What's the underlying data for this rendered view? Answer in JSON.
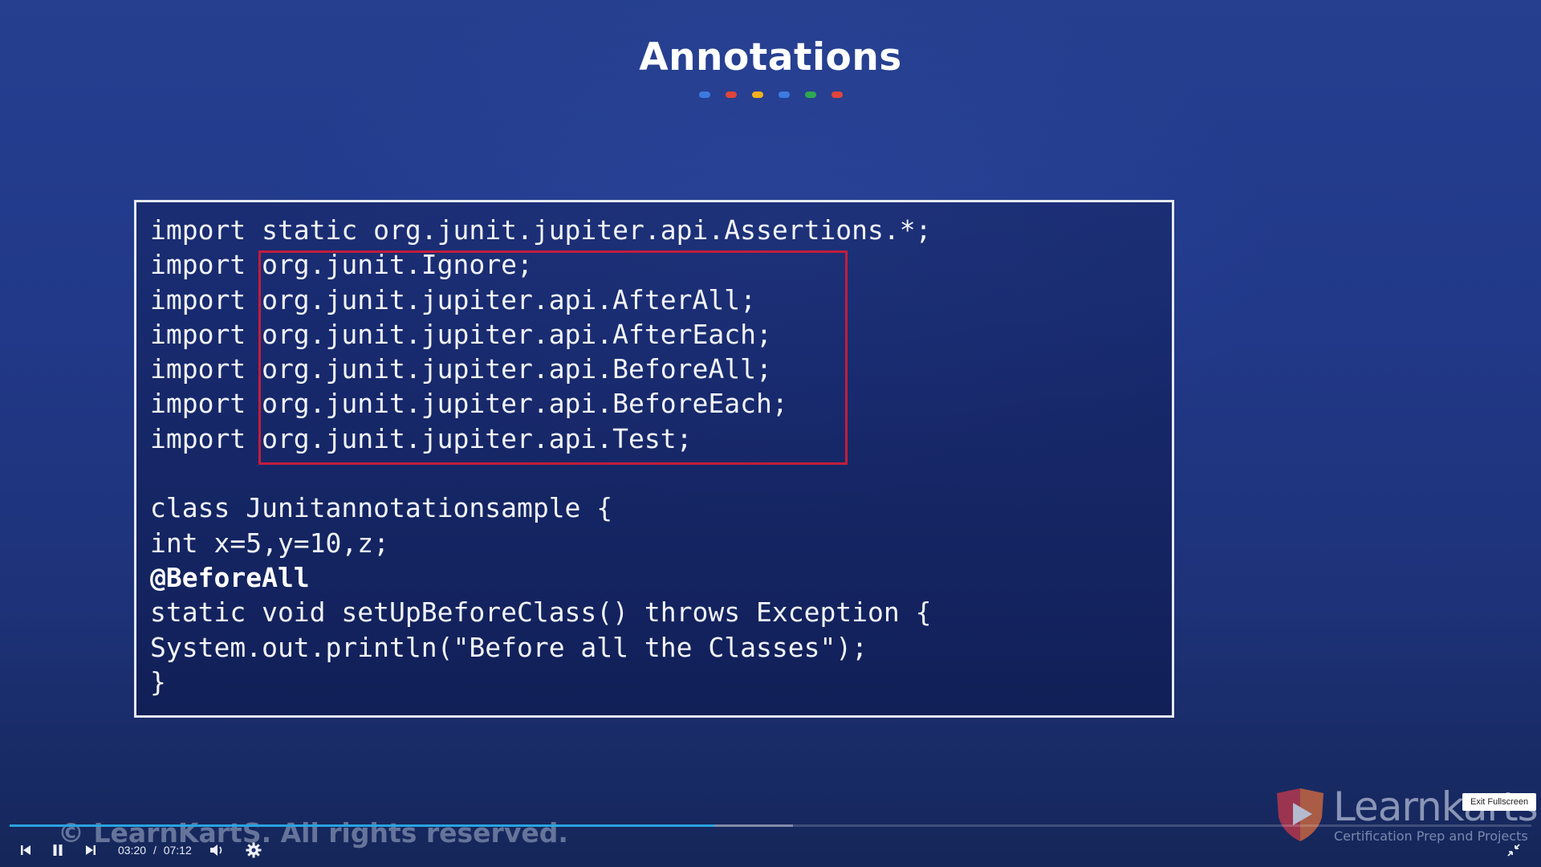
{
  "slide": {
    "title": "Annotations",
    "dot_colors": [
      "#3b7be0",
      "#e0453a",
      "#f2b11e",
      "#3b7be0",
      "#2ea84f",
      "#e0453a"
    ],
    "code_lines": [
      {
        "text": "import static org.junit.jupiter.api.Assertions.*;",
        "bold": false
      },
      {
        "text": "import org.junit.Ignore;",
        "bold": false
      },
      {
        "text": "import org.junit.jupiter.api.AfterAll;",
        "bold": false
      },
      {
        "text": "import org.junit.jupiter.api.AfterEach;",
        "bold": false
      },
      {
        "text": "import org.junit.jupiter.api.BeforeAll;",
        "bold": false
      },
      {
        "text": "import org.junit.jupiter.api.BeforeEach;",
        "bold": false
      },
      {
        "text": "import org.junit.jupiter.api.Test;",
        "bold": false
      },
      {
        "text": "",
        "bold": false
      },
      {
        "text": "class Junitannotationsample {",
        "bold": false
      },
      {
        "text": "int x=5,y=10,z;",
        "bold": false
      },
      {
        "text": "@BeforeAll",
        "bold": true
      },
      {
        "text": "static void setUpBeforeClass() throws Exception {",
        "bold": false
      },
      {
        "text": "System.out.println(\"Before all the Classes\");",
        "bold": false
      },
      {
        "text": "}",
        "bold": false
      }
    ],
    "highlight_color": "#c21d3c",
    "copyright": "© LearnKartS. All rights reserved.",
    "brand": {
      "name": "Learnkarts",
      "tagline": "Certification Prep and Projects"
    }
  },
  "player": {
    "current_time": "03:20",
    "separator": "/",
    "duration": "07:12",
    "played_fraction": 0.463,
    "buffered_fraction": 0.515,
    "accent_color": "#2aa3df",
    "exit_fullscreen_tooltip": "Exit Fullscreen",
    "icons": {
      "previous": "skip-previous-icon",
      "pause": "pause-icon",
      "next": "skip-next-icon",
      "volume": "volume-icon",
      "settings": "gear-icon",
      "exit_fullscreen": "exit-fullscreen-icon"
    }
  }
}
